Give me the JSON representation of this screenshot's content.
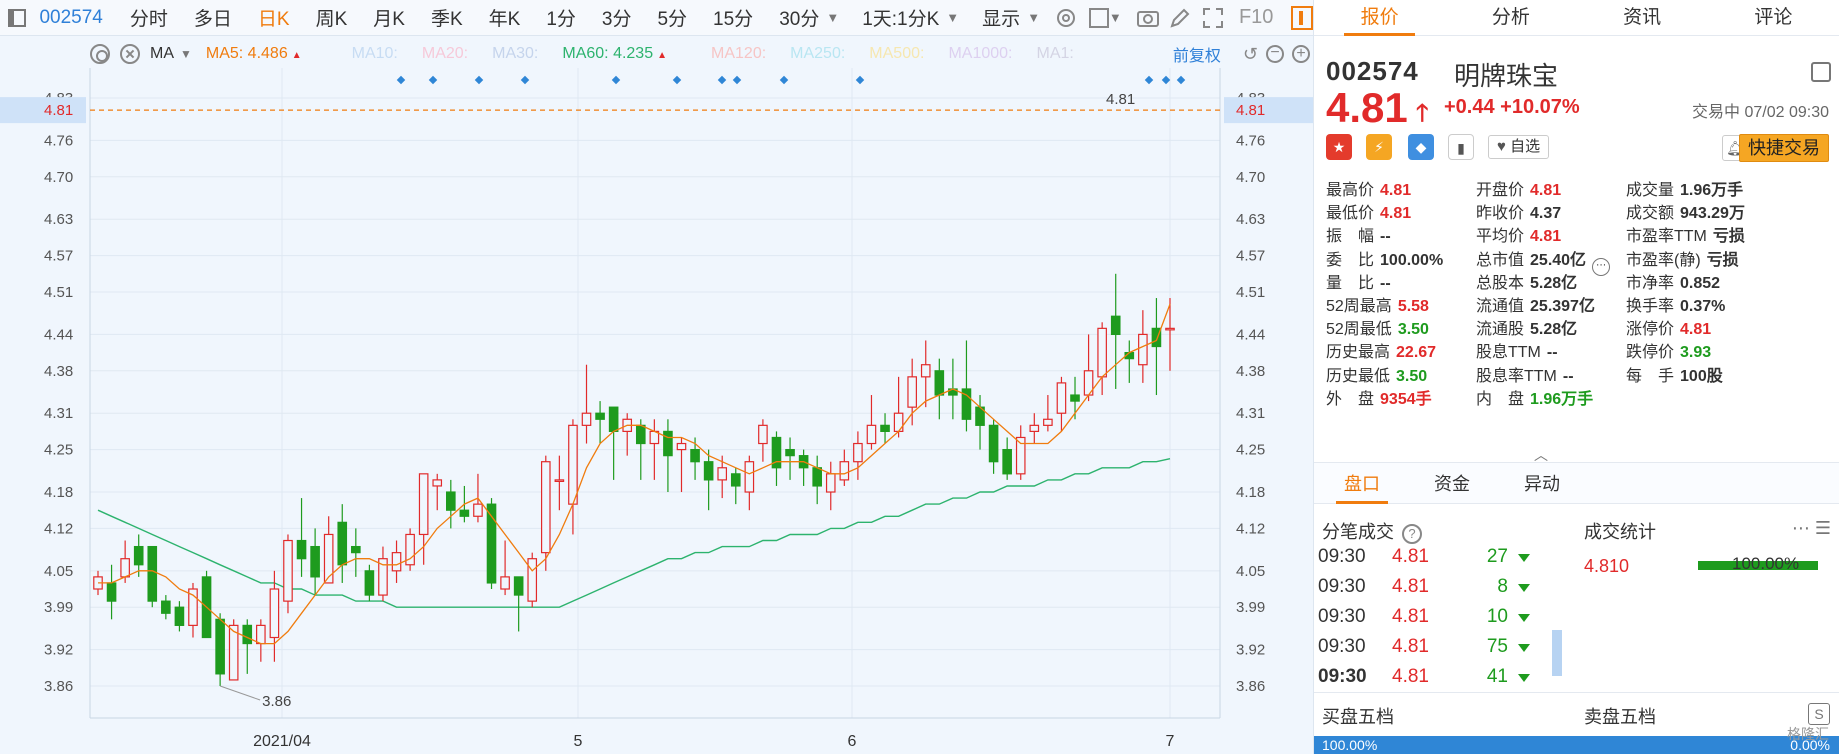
{
  "toolbar": {
    "code": "002574",
    "periods": [
      "分时",
      "多日",
      "日K",
      "周K",
      "月K",
      "季K",
      "年K",
      "1分",
      "3分",
      "5分",
      "15分",
      "30分"
    ],
    "active": "日K",
    "range": "1天:1分K",
    "display": "显示",
    "f10": "F10"
  },
  "ma": {
    "label": "MA",
    "ma5": "MA5: 4.486",
    "ma10": "MA10:",
    "ma20": "MA20:",
    "ma30": "MA30:",
    "ma60": "MA60: 4.235",
    "ma120": "MA120:",
    "ma250": "MA250:",
    "ma500": "MA500:",
    "ma1000": "MA1000:",
    "ma1": "MA1:",
    "adjust": "前复权",
    "colors": {
      "ma5": "#f07c0e",
      "ma10": "#c7dcf3",
      "ma20": "#f6c9d9",
      "ma30": "#c5d4ec",
      "ma60": "#2db36e",
      "ma120": "#f6c5c5",
      "ma250": "#b9e6f2",
      "ma500": "#f6e7b0",
      "ma1000": "#ddd0f0",
      "ma1": "#d4d4e4"
    }
  },
  "chart_data": {
    "type": "candlestick",
    "y_ticks": [
      "4.83",
      "4.76",
      "4.70",
      "4.63",
      "4.57",
      "4.51",
      "4.44",
      "4.38",
      "4.31",
      "4.25",
      "4.18",
      "4.12",
      "4.05",
      "3.99",
      "3.92",
      "3.86"
    ],
    "ylim": [
      3.86,
      4.83
    ],
    "x_ticks": [
      "2021/04",
      "5",
      "6",
      "7"
    ],
    "current_price_label": "4.81",
    "high_annotation": "4.81",
    "low_annotation": "3.86",
    "up_color": "#e12a2a",
    "down_color": "#1e9b1e",
    "candles": [
      [
        4.02,
        4.04,
        4.01,
        4.05
      ],
      [
        4.03,
        4.0,
        3.97,
        4.06
      ],
      [
        4.04,
        4.07,
        4.03,
        4.1
      ],
      [
        4.09,
        4.06,
        4.04,
        4.11
      ],
      [
        4.09,
        4.0,
        3.99,
        4.09
      ],
      [
        4.0,
        3.98,
        3.97,
        4.01
      ],
      [
        3.99,
        3.96,
        3.95,
        4.0
      ],
      [
        3.96,
        4.02,
        3.94,
        4.03
      ],
      [
        4.04,
        3.94,
        3.94,
        4.05
      ],
      [
        3.97,
        3.88,
        3.86,
        3.98
      ],
      [
        3.87,
        3.96,
        3.87,
        3.97
      ],
      [
        3.96,
        3.93,
        3.88,
        3.97
      ],
      [
        3.93,
        3.96,
        3.9,
        3.97
      ],
      [
        3.94,
        4.02,
        3.9,
        4.05
      ],
      [
        4.0,
        4.1,
        3.98,
        4.11
      ],
      [
        4.1,
        4.07,
        4.04,
        4.17
      ],
      [
        4.09,
        4.04,
        4.01,
        4.12
      ],
      [
        4.03,
        4.11,
        4.03,
        4.14
      ],
      [
        4.13,
        4.06,
        4.03,
        4.16
      ],
      [
        4.09,
        4.08,
        4.04,
        4.12
      ],
      [
        4.05,
        4.01,
        4.0,
        4.06
      ],
      [
        4.01,
        4.07,
        4.0,
        4.09
      ],
      [
        4.05,
        4.08,
        4.03,
        4.1
      ],
      [
        4.06,
        4.11,
        4.05,
        4.12
      ],
      [
        4.11,
        4.21,
        4.06,
        4.21
      ],
      [
        4.19,
        4.2,
        4.15,
        4.21
      ],
      [
        4.18,
        4.15,
        4.12,
        4.2
      ],
      [
        4.15,
        4.14,
        4.13,
        4.19
      ],
      [
        4.14,
        4.16,
        4.13,
        4.21
      ],
      [
        4.16,
        4.03,
        4.02,
        4.17
      ],
      [
        4.02,
        4.04,
        4.01,
        4.1
      ],
      [
        4.04,
        4.01,
        3.95,
        4.04
      ],
      [
        4.0,
        4.07,
        3.99,
        4.08
      ],
      [
        4.08,
        4.23,
        4.05,
        4.24
      ],
      [
        4.2,
        4.2,
        4.15,
        4.24
      ],
      [
        4.16,
        4.29,
        4.11,
        4.3
      ],
      [
        4.29,
        4.31,
        4.26,
        4.39
      ],
      [
        4.31,
        4.3,
        4.26,
        4.33
      ],
      [
        4.32,
        4.28,
        4.2,
        4.32
      ],
      [
        4.28,
        4.3,
        4.24,
        4.31
      ],
      [
        4.29,
        4.26,
        4.2,
        4.3
      ],
      [
        4.26,
        4.28,
        4.2,
        4.3
      ],
      [
        4.28,
        4.24,
        4.18,
        4.3
      ],
      [
        4.25,
        4.26,
        4.18,
        4.27
      ],
      [
        4.25,
        4.23,
        4.2,
        4.27
      ],
      [
        4.23,
        4.2,
        4.15,
        4.25
      ],
      [
        4.2,
        4.22,
        4.17,
        4.24
      ],
      [
        4.21,
        4.19,
        4.16,
        4.22
      ],
      [
        4.18,
        4.23,
        4.15,
        4.24
      ],
      [
        4.26,
        4.29,
        4.23,
        4.3
      ],
      [
        4.27,
        4.22,
        4.19,
        4.28
      ],
      [
        4.25,
        4.24,
        4.2,
        4.27
      ],
      [
        4.24,
        4.22,
        4.19,
        4.25
      ],
      [
        4.22,
        4.19,
        4.16,
        4.24
      ],
      [
        4.18,
        4.21,
        4.15,
        4.23
      ],
      [
        4.2,
        4.23,
        4.19,
        4.25
      ],
      [
        4.23,
        4.26,
        4.2,
        4.28
      ],
      [
        4.26,
        4.29,
        4.25,
        4.34
      ],
      [
        4.29,
        4.28,
        4.26,
        4.31
      ],
      [
        4.28,
        4.31,
        4.27,
        4.37
      ],
      [
        4.32,
        4.37,
        4.29,
        4.4
      ],
      [
        4.37,
        4.39,
        4.32,
        4.43
      ],
      [
        4.38,
        4.34,
        4.3,
        4.4
      ],
      [
        4.35,
        4.34,
        4.3,
        4.4
      ],
      [
        4.35,
        4.3,
        4.28,
        4.43
      ],
      [
        4.32,
        4.29,
        4.25,
        4.34
      ],
      [
        4.29,
        4.23,
        4.21,
        4.3
      ],
      [
        4.25,
        4.21,
        4.2,
        4.27
      ],
      [
        4.21,
        4.27,
        4.2,
        4.29
      ],
      [
        4.28,
        4.29,
        4.26,
        4.31
      ],
      [
        4.29,
        4.3,
        4.28,
        4.34
      ],
      [
        4.31,
        4.36,
        4.28,
        4.37
      ],
      [
        4.34,
        4.33,
        4.3,
        4.37
      ],
      [
        4.34,
        4.38,
        4.33,
        4.44
      ],
      [
        4.37,
        4.45,
        4.34,
        4.46
      ],
      [
        4.47,
        4.44,
        4.35,
        4.54
      ],
      [
        4.41,
        4.4,
        4.36,
        4.43
      ],
      [
        4.39,
        4.44,
        4.36,
        4.48
      ],
      [
        4.45,
        4.42,
        4.34,
        4.5
      ],
      [
        4.45,
        4.45,
        4.38,
        4.5
      ]
    ],
    "ma5": [
      4.03,
      4.03,
      4.04,
      4.05,
      4.05,
      4.04,
      4.02,
      4.01,
      3.99,
      3.97,
      3.95,
      3.94,
      3.93,
      3.93,
      3.95,
      3.98,
      4.01,
      4.04,
      4.06,
      4.07,
      4.07,
      4.06,
      4.06,
      4.07,
      4.09,
      4.12,
      4.14,
      4.16,
      4.17,
      4.14,
      4.11,
      4.08,
      4.05,
      4.07,
      4.11,
      4.16,
      4.22,
      4.26,
      4.28,
      4.29,
      4.29,
      4.28,
      4.27,
      4.27,
      4.26,
      4.24,
      4.23,
      4.22,
      4.21,
      4.22,
      4.23,
      4.23,
      4.23,
      4.22,
      4.21,
      4.21,
      4.22,
      4.24,
      4.26,
      4.28,
      4.31,
      4.33,
      4.34,
      4.35,
      4.34,
      4.32,
      4.3,
      4.28,
      4.26,
      4.26,
      4.26,
      4.28,
      4.31,
      4.34,
      4.37,
      4.39,
      4.41,
      4.42,
      4.43,
      4.49
    ],
    "ma60": [
      4.15,
      4.14,
      4.13,
      4.12,
      4.11,
      4.1,
      4.09,
      4.08,
      4.07,
      4.06,
      4.05,
      4.04,
      4.03,
      4.03,
      4.02,
      4.02,
      4.01,
      4.01,
      4.01,
      4.0,
      4.0,
      4.0,
      3.99,
      3.99,
      3.99,
      3.99,
      3.99,
      3.99,
      3.99,
      3.99,
      3.99,
      3.99,
      3.99,
      3.99,
      3.99,
      4.0,
      4.01,
      4.02,
      4.03,
      4.04,
      4.05,
      4.06,
      4.07,
      4.07,
      4.08,
      4.08,
      4.09,
      4.09,
      4.09,
      4.1,
      4.1,
      4.11,
      4.11,
      4.11,
      4.12,
      4.12,
      4.13,
      4.13,
      4.14,
      4.14,
      4.15,
      4.16,
      4.16,
      4.17,
      4.17,
      4.18,
      4.18,
      4.19,
      4.19,
      4.19,
      4.2,
      4.2,
      4.21,
      4.21,
      4.22,
      4.22,
      4.22,
      4.23,
      4.23,
      4.235
    ],
    "markers_top": 15
  },
  "panel": {
    "tabs": [
      "报价",
      "分析",
      "资讯",
      "评论"
    ],
    "code": "002574",
    "name": "明牌珠宝",
    "price": "4.81",
    "change": "+0.44",
    "change_pct": "+10.07%",
    "status": "交易中 07/02 09:30",
    "fav": "自选",
    "quick": "快捷交易",
    "stats": [
      [
        [
          "最高价",
          "4.81",
          "r"
        ],
        [
          "开盘价",
          "4.81",
          "r"
        ],
        [
          "成交量",
          "1.96万手",
          "k"
        ]
      ],
      [
        [
          "最低价",
          "4.81",
          "r"
        ],
        [
          "昨收价",
          "4.37",
          "k"
        ],
        [
          "成交额",
          "943.29万",
          "k"
        ]
      ],
      [
        [
          "振　幅",
          "--",
          "k"
        ],
        [
          "平均价",
          "4.81",
          "r"
        ],
        [
          "市盈率TTM",
          "亏损",
          "k"
        ]
      ],
      [
        [
          "委　比",
          "100.00%",
          "k"
        ],
        [
          "总市值",
          "25.40亿",
          "k"
        ],
        [
          "市盈率(静)",
          "亏损",
          "k"
        ]
      ],
      [
        [
          "量　比",
          "--",
          "k"
        ],
        [
          "总股本",
          "5.28亿",
          "k"
        ],
        [
          "市净率",
          "0.852",
          "k"
        ]
      ],
      [
        [
          "52周最高",
          "5.58",
          "r"
        ],
        [
          "流通值",
          "25.397亿",
          "k"
        ],
        [
          "换手率",
          "0.37%",
          "k"
        ]
      ],
      [
        [
          "52周最低",
          "3.50",
          "g"
        ],
        [
          "流通股",
          "5.28亿",
          "k"
        ],
        [
          "涨停价",
          "4.81",
          "r"
        ]
      ],
      [
        [
          "历史最高",
          "22.67",
          "r"
        ],
        [
          "股息TTM",
          "--",
          "k"
        ],
        [
          "跌停价",
          "3.93",
          "g"
        ]
      ],
      [
        [
          "历史最低",
          "3.50",
          "g"
        ],
        [
          "股息率TTM",
          "--",
          "k"
        ],
        [
          "每　手",
          "100股",
          "k"
        ]
      ],
      [
        [
          "外　盘",
          "9354手",
          "r"
        ],
        [
          "内　盘",
          "1.96万手",
          "g"
        ],
        [
          "",
          ""
        ]
      ]
    ],
    "subtabs": [
      "盘口",
      "资金",
      "异动"
    ],
    "trades_title": "分笔成交",
    "stat_title": "成交统计",
    "trades": [
      {
        "time": "09:30",
        "price": "4.81",
        "vol": "27"
      },
      {
        "time": "09:30",
        "price": "4.81",
        "vol": "8"
      },
      {
        "time": "09:30",
        "price": "4.81",
        "vol": "10"
      },
      {
        "time": "09:30",
        "price": "4.81",
        "vol": "75"
      },
      {
        "time": "09:30",
        "price": "4.81",
        "vol": "41"
      }
    ],
    "stat_price": "4.810",
    "stat_pct": "100.00%",
    "buy5": "买盘五档",
    "sell5": "卖盘五档",
    "strip_left": "100.00%",
    "strip_right": "0.00%",
    "watermark": "格隆汇"
  }
}
